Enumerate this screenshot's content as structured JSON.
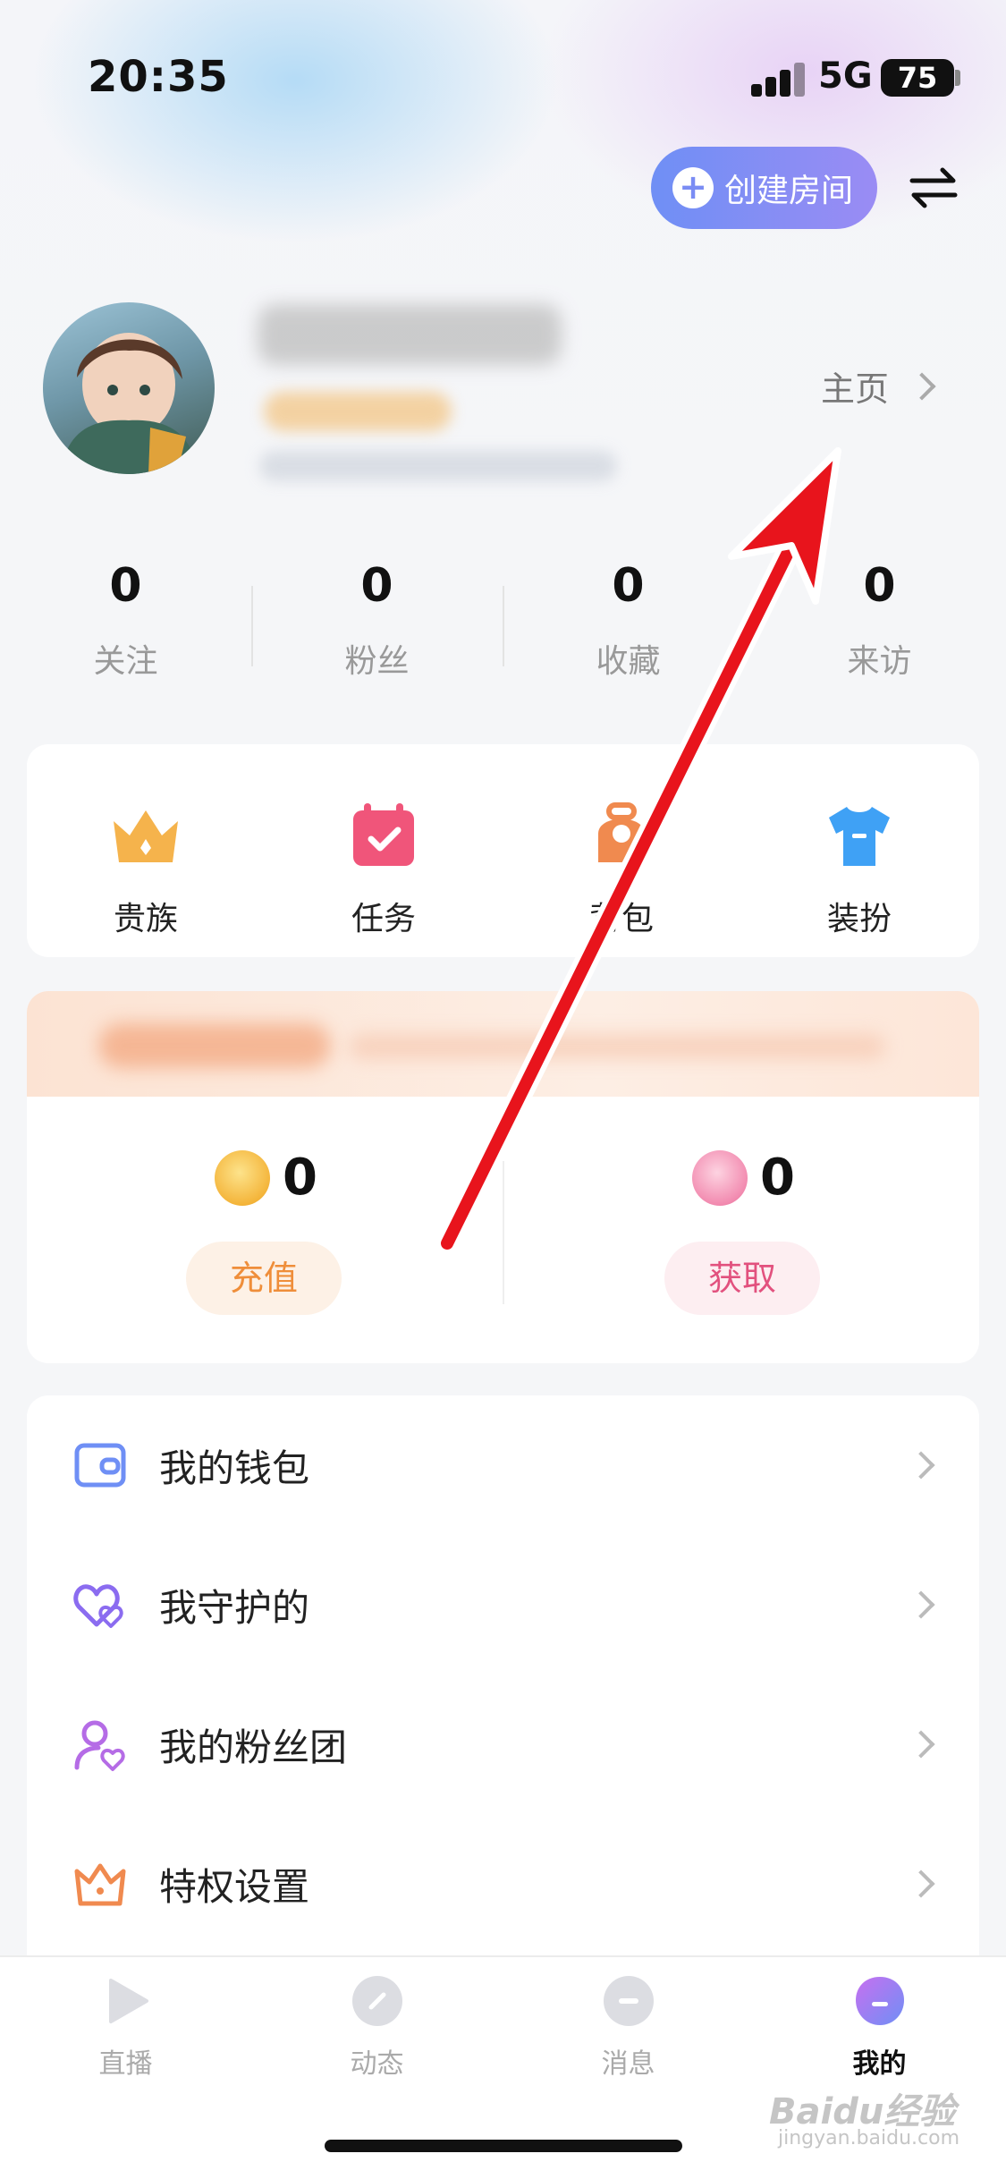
{
  "status_bar": {
    "time": "20:35",
    "network": "5G",
    "battery": "75"
  },
  "header": {
    "create_room_label": "创建房间"
  },
  "profile": {
    "homepage_label": "主页"
  },
  "stats": [
    {
      "value": "0",
      "label": "关注"
    },
    {
      "value": "0",
      "label": "粉丝"
    },
    {
      "value": "0",
      "label": "收藏"
    },
    {
      "value": "0",
      "label": "来访"
    }
  ],
  "quick_actions": [
    {
      "label": "贵族",
      "icon": "crown-icon",
      "color": "#f5b34c"
    },
    {
      "label": "任务",
      "icon": "calendar-check-icon",
      "color": "#f0557a"
    },
    {
      "label": "背包",
      "icon": "backpack-icon",
      "color": "#f08a4f"
    },
    {
      "label": "装扮",
      "icon": "tshirt-icon",
      "color": "#3fa1f5"
    }
  ],
  "wallet": {
    "gold_coin_value": "0",
    "pink_coin_value": "0",
    "recharge_label": "充值",
    "obtain_label": "获取"
  },
  "menu": [
    {
      "label": "我的钱包",
      "icon": "wallet-icon"
    },
    {
      "label": "我守护的",
      "icon": "hearts-icon"
    },
    {
      "label": "我的粉丝团",
      "icon": "user-heart-icon"
    },
    {
      "label": "特权设置",
      "icon": "crown-outline-icon"
    }
  ],
  "tabbar": [
    {
      "label": "直播",
      "icon": "play-icon",
      "active": false
    },
    {
      "label": "动态",
      "icon": "compass-icon",
      "active": false
    },
    {
      "label": "消息",
      "icon": "message-icon",
      "active": false
    },
    {
      "label": "我的",
      "icon": "profile-icon",
      "active": true
    }
  ],
  "watermark": {
    "main": "Baidu经验",
    "sub": "jingyan.baidu.com"
  },
  "colors": {
    "accent_gradient_start": "#6f8ff5",
    "accent_gradient_end": "#9a8cf4",
    "annotation_arrow": "#e8141c"
  }
}
